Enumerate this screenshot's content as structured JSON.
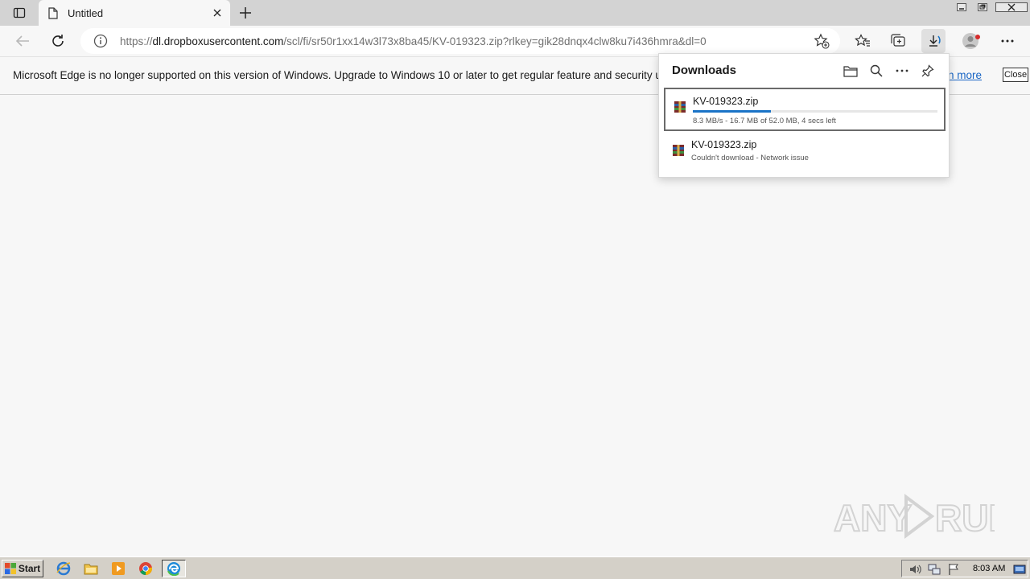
{
  "browser": {
    "tab": {
      "title": "Untitled"
    },
    "address": {
      "prefix": "https://",
      "host": "dl.dropboxusercontent.com",
      "path": "/scl/fi/sr50r1xx14w3l73x8ba45/KV-019323.zip?rlkey=gik28dnqx4clw8ku7i436hmra&dl=0"
    }
  },
  "infobar": {
    "message": "Microsoft Edge is no longer supported on this version of Windows. Upgrade to Windows 10 or later to get regular feature and security updates.",
    "learn_more": "arn more",
    "close": "Close"
  },
  "downloads": {
    "title": "Downloads",
    "items": [
      {
        "filename": "KV-019323.zip",
        "status": "8.3 MB/s - 16.7 MB of 52.0 MB, 4 secs left",
        "progress": 0.32
      },
      {
        "filename": "KV-019323.zip",
        "status": "Couldn't download - Network issue"
      }
    ]
  },
  "taskbar": {
    "start_label": "Start",
    "clock": "8:03 AM"
  },
  "watermark": {
    "text": "ANY RUN"
  },
  "colors": {
    "accent": "#1a73c7",
    "link": "#1764c4",
    "taskbar": "#d4d0c8"
  }
}
